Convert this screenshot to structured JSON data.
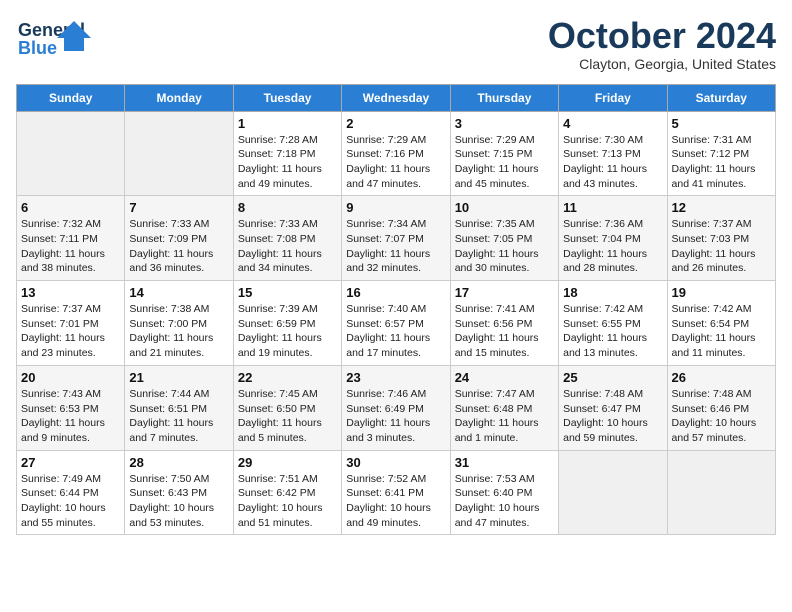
{
  "header": {
    "logo": {
      "line1": "General",
      "line2": "Blue"
    },
    "title": "October 2024",
    "location": "Clayton, Georgia, United States"
  },
  "days_of_week": [
    "Sunday",
    "Monday",
    "Tuesday",
    "Wednesday",
    "Thursday",
    "Friday",
    "Saturday"
  ],
  "weeks": [
    [
      {
        "day": null
      },
      {
        "day": null
      },
      {
        "day": "1",
        "sunrise": "7:28 AM",
        "sunset": "7:18 PM",
        "daylight": "11 hours and 49 minutes."
      },
      {
        "day": "2",
        "sunrise": "7:29 AM",
        "sunset": "7:16 PM",
        "daylight": "11 hours and 47 minutes."
      },
      {
        "day": "3",
        "sunrise": "7:29 AM",
        "sunset": "7:15 PM",
        "daylight": "11 hours and 45 minutes."
      },
      {
        "day": "4",
        "sunrise": "7:30 AM",
        "sunset": "7:13 PM",
        "daylight": "11 hours and 43 minutes."
      },
      {
        "day": "5",
        "sunrise": "7:31 AM",
        "sunset": "7:12 PM",
        "daylight": "11 hours and 41 minutes."
      }
    ],
    [
      {
        "day": "6",
        "sunrise": "7:32 AM",
        "sunset": "7:11 PM",
        "daylight": "11 hours and 38 minutes."
      },
      {
        "day": "7",
        "sunrise": "7:33 AM",
        "sunset": "7:09 PM",
        "daylight": "11 hours and 36 minutes."
      },
      {
        "day": "8",
        "sunrise": "7:33 AM",
        "sunset": "7:08 PM",
        "daylight": "11 hours and 34 minutes."
      },
      {
        "day": "9",
        "sunrise": "7:34 AM",
        "sunset": "7:07 PM",
        "daylight": "11 hours and 32 minutes."
      },
      {
        "day": "10",
        "sunrise": "7:35 AM",
        "sunset": "7:05 PM",
        "daylight": "11 hours and 30 minutes."
      },
      {
        "day": "11",
        "sunrise": "7:36 AM",
        "sunset": "7:04 PM",
        "daylight": "11 hours and 28 minutes."
      },
      {
        "day": "12",
        "sunrise": "7:37 AM",
        "sunset": "7:03 PM",
        "daylight": "11 hours and 26 minutes."
      }
    ],
    [
      {
        "day": "13",
        "sunrise": "7:37 AM",
        "sunset": "7:01 PM",
        "daylight": "11 hours and 23 minutes."
      },
      {
        "day": "14",
        "sunrise": "7:38 AM",
        "sunset": "7:00 PM",
        "daylight": "11 hours and 21 minutes."
      },
      {
        "day": "15",
        "sunrise": "7:39 AM",
        "sunset": "6:59 PM",
        "daylight": "11 hours and 19 minutes."
      },
      {
        "day": "16",
        "sunrise": "7:40 AM",
        "sunset": "6:57 PM",
        "daylight": "11 hours and 17 minutes."
      },
      {
        "day": "17",
        "sunrise": "7:41 AM",
        "sunset": "6:56 PM",
        "daylight": "11 hours and 15 minutes."
      },
      {
        "day": "18",
        "sunrise": "7:42 AM",
        "sunset": "6:55 PM",
        "daylight": "11 hours and 13 minutes."
      },
      {
        "day": "19",
        "sunrise": "7:42 AM",
        "sunset": "6:54 PM",
        "daylight": "11 hours and 11 minutes."
      }
    ],
    [
      {
        "day": "20",
        "sunrise": "7:43 AM",
        "sunset": "6:53 PM",
        "daylight": "11 hours and 9 minutes."
      },
      {
        "day": "21",
        "sunrise": "7:44 AM",
        "sunset": "6:51 PM",
        "daylight": "11 hours and 7 minutes."
      },
      {
        "day": "22",
        "sunrise": "7:45 AM",
        "sunset": "6:50 PM",
        "daylight": "11 hours and 5 minutes."
      },
      {
        "day": "23",
        "sunrise": "7:46 AM",
        "sunset": "6:49 PM",
        "daylight": "11 hours and 3 minutes."
      },
      {
        "day": "24",
        "sunrise": "7:47 AM",
        "sunset": "6:48 PM",
        "daylight": "11 hours and 1 minute."
      },
      {
        "day": "25",
        "sunrise": "7:48 AM",
        "sunset": "6:47 PM",
        "daylight": "10 hours and 59 minutes."
      },
      {
        "day": "26",
        "sunrise": "7:48 AM",
        "sunset": "6:46 PM",
        "daylight": "10 hours and 57 minutes."
      }
    ],
    [
      {
        "day": "27",
        "sunrise": "7:49 AM",
        "sunset": "6:44 PM",
        "daylight": "10 hours and 55 minutes."
      },
      {
        "day": "28",
        "sunrise": "7:50 AM",
        "sunset": "6:43 PM",
        "daylight": "10 hours and 53 minutes."
      },
      {
        "day": "29",
        "sunrise": "7:51 AM",
        "sunset": "6:42 PM",
        "daylight": "10 hours and 51 minutes."
      },
      {
        "day": "30",
        "sunrise": "7:52 AM",
        "sunset": "6:41 PM",
        "daylight": "10 hours and 49 minutes."
      },
      {
        "day": "31",
        "sunrise": "7:53 AM",
        "sunset": "6:40 PM",
        "daylight": "10 hours and 47 minutes."
      },
      {
        "day": null
      },
      {
        "day": null
      }
    ]
  ]
}
